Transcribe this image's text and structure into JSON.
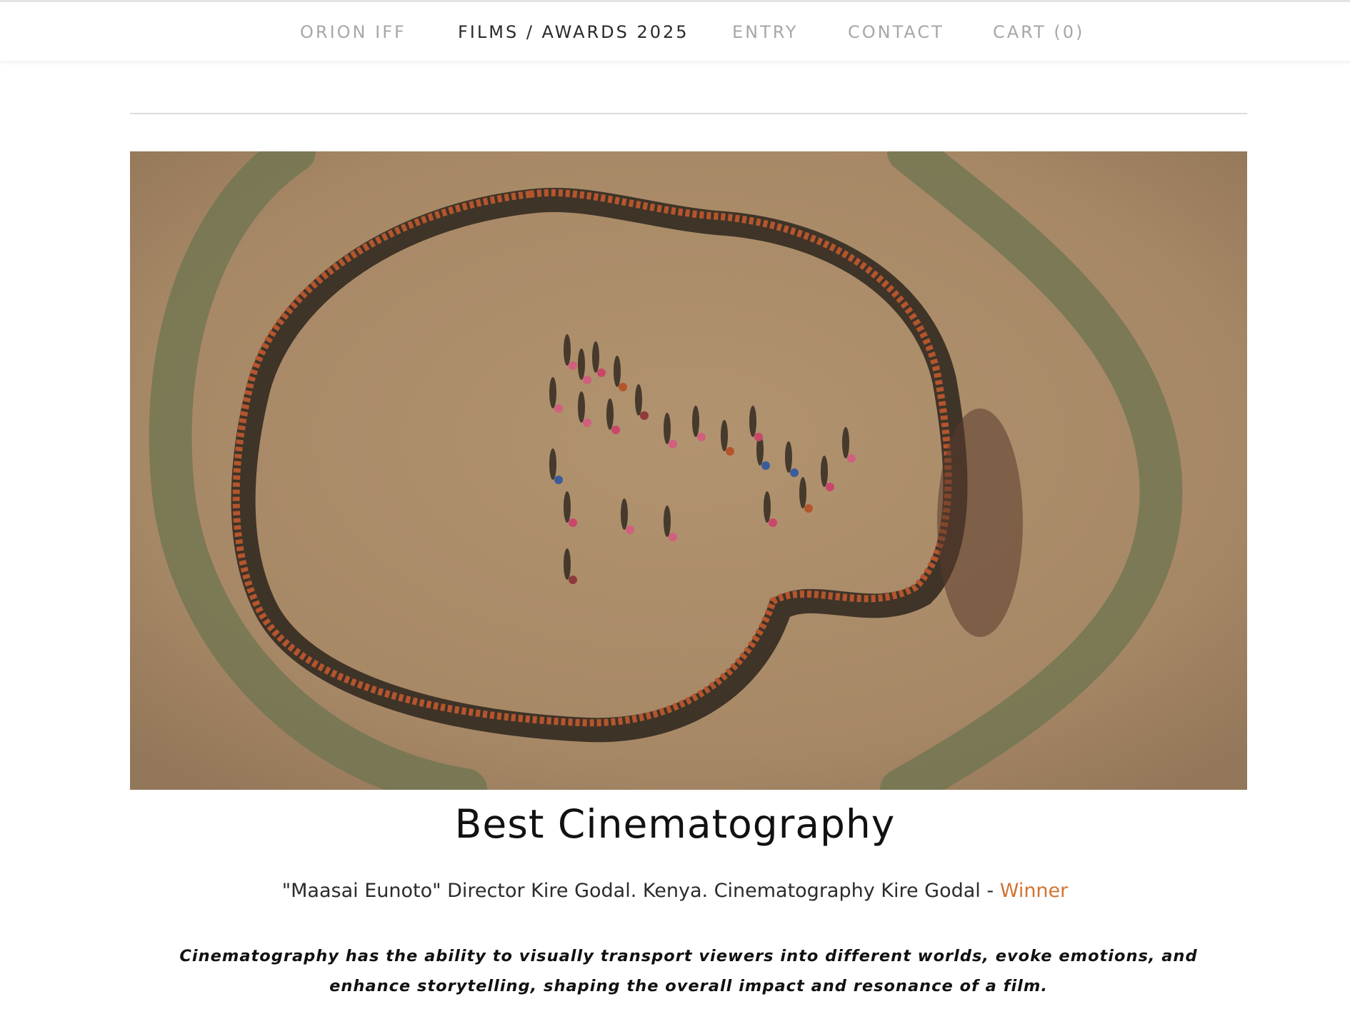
{
  "nav": {
    "items": [
      {
        "label": "ORION IFF",
        "active": false
      },
      {
        "label": "FILMS / AWARDS 2025",
        "active": true
      },
      {
        "label": "ENTRY",
        "active": false
      },
      {
        "label": "CONTACT",
        "active": false
      },
      {
        "label": "CART (0)",
        "active": false
      }
    ]
  },
  "hero_image": {
    "subject": "aerial photo of a crowd standing in a large ring on dry earth",
    "ground_color": "#a88a66",
    "vegetation_color": "#6e7450"
  },
  "award": {
    "title": "Best Cinematography",
    "credit": "\"Maasai Eunoto\" Director Kire Godal. Kenya. Cinematography Kire Godal - ",
    "result": "Winner",
    "result_color": "#d17434",
    "description": "Cinematography has the ability to visually transport viewers into different worlds, evoke emotions, and enhance storytelling, shaping the overall impact and resonance of a film."
  }
}
